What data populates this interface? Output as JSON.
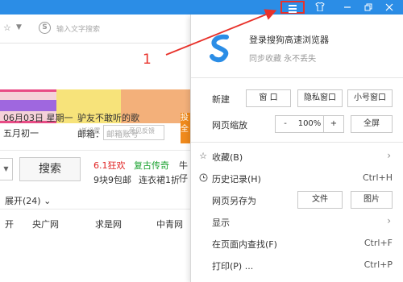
{
  "addressbar": {
    "search_placeholder": "输入文字搜索"
  },
  "page": {
    "date_line1": "06月03日 星期一",
    "date_line2": "五月初一",
    "friend_text": "驴友不敢听的歌",
    "mail_label": "邮箱：",
    "mail_placeholder": "邮箱账号",
    "sub_bar": [
      "I任设置",
      "意见反馈"
    ],
    "badge_text": "投全",
    "search_button": "搜索",
    "promo": [
      "6.1狂欢",
      "复古传奇",
      "牛仔",
      "9块9包邮",
      "连衣裙1折"
    ],
    "expand_label": "展开(24)",
    "sites": [
      "开",
      "央广网",
      "求是网",
      "中青网"
    ]
  },
  "annotation": {
    "number": "1"
  },
  "menu": {
    "title": "登录搜狗高速浏览器",
    "subtitle": "同步收藏 永不丢失",
    "new_label": "新建",
    "new_buttons": [
      "窗 口",
      "隐私窗口",
      "小号窗口"
    ],
    "zoom_label": "网页缩放",
    "zoom_minus": "-",
    "zoom_value": "100%",
    "zoom_plus": "+",
    "fullscreen": "全屏",
    "items": [
      {
        "label": "收藏(B)",
        "shortcut": "",
        "has_submenu": true
      },
      {
        "label": "历史记录(H)",
        "shortcut": "Ctrl+H",
        "has_submenu": false
      },
      {
        "label": "网页另存为",
        "shortcut": "",
        "has_submenu": false
      },
      {
        "label": "显示",
        "shortcut": "",
        "has_submenu": true
      },
      {
        "label": "在页面内查找(F)",
        "shortcut": "Ctrl+F",
        "has_submenu": false
      },
      {
        "label": "打印(P) ...",
        "shortcut": "Ctrl+P",
        "has_submenu": false
      }
    ],
    "save_buttons": [
      "文件",
      "图片"
    ]
  },
  "colors": {
    "titlebar": "#2b8de6",
    "highlight": "#e8322b"
  }
}
